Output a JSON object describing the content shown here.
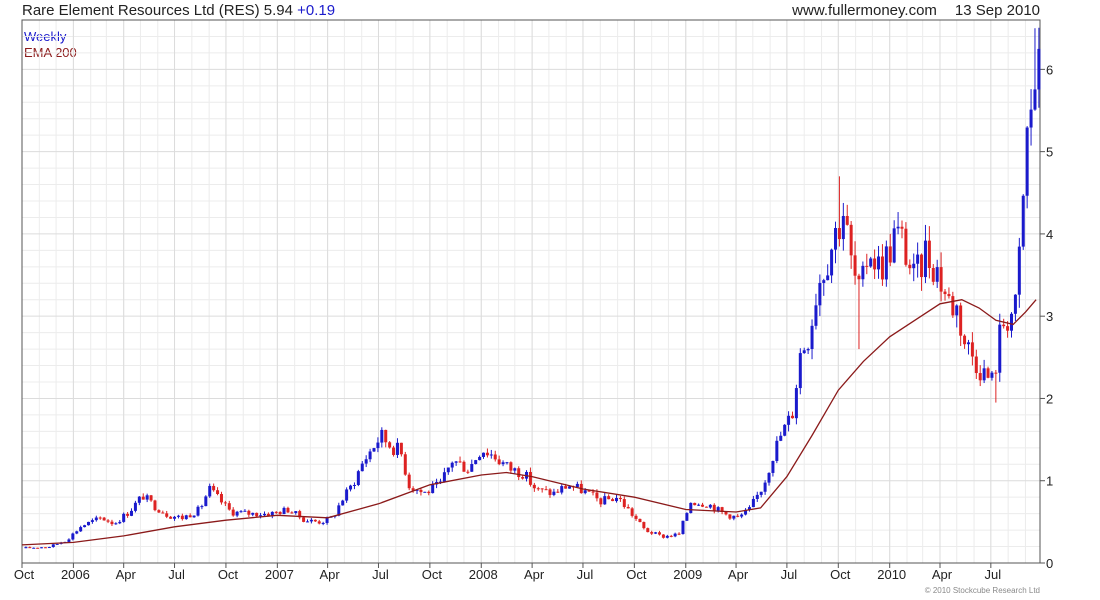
{
  "header": {
    "title": "Rare Element Resources Ltd (RES) 5.94",
    "change": "+0.19",
    "site": "www.fullermoney.com",
    "date": "13 Sep 2010"
  },
  "legend": {
    "weekly": "Weekly",
    "ema": "EMA 200"
  },
  "copyright": "© 2010 Stockcube Research Ltd",
  "colors": {
    "up": "#1a1acc",
    "down": "#dd2222",
    "ema": "#8b1a1a",
    "grid": "#dcdcdc",
    "axis": "#555555"
  },
  "chart_data": {
    "type": "candlestick",
    "frequency": "weekly",
    "ylim": [
      0,
      6.6
    ],
    "yticks": [
      0,
      1,
      2,
      3,
      4,
      5,
      6
    ],
    "xticks": [
      "Oct",
      "2006",
      "Apr",
      "Jul",
      "Oct",
      "2007",
      "Apr",
      "Jul",
      "Oct",
      "2008",
      "Apr",
      "Jul",
      "Oct",
      "2009",
      "Apr",
      "Jul",
      "Oct",
      "2010",
      "Apr",
      "Jul"
    ],
    "xtick_dates": [
      "2005-10-01",
      "2006-01-01",
      "2006-04-01",
      "2006-07-01",
      "2006-10-01",
      "2007-01-01",
      "2007-04-01",
      "2007-07-01",
      "2007-10-01",
      "2008-01-01",
      "2008-04-01",
      "2008-07-01",
      "2008-10-01",
      "2009-01-01",
      "2009-04-01",
      "2009-07-01",
      "2009-10-01",
      "2010-01-01",
      "2010-04-01",
      "2010-07-01"
    ],
    "x_range": [
      "2005-10-01",
      "2010-09-27"
    ],
    "close_path": [
      [
        "2005-10-01",
        0.18
      ],
      [
        "2005-11-20",
        0.2
      ],
      [
        "2005-12-20",
        0.28
      ],
      [
        "2006-01-15",
        0.45
      ],
      [
        "2006-02-20",
        0.55
      ],
      [
        "2006-03-15",
        0.48
      ],
      [
        "2006-04-10",
        0.62
      ],
      [
        "2006-05-05",
        0.82
      ],
      [
        "2006-05-25",
        0.7
      ],
      [
        "2006-06-20",
        0.58
      ],
      [
        "2006-07-15",
        0.55
      ],
      [
        "2006-08-15",
        0.65
      ],
      [
        "2006-09-01",
        0.9
      ],
      [
        "2006-10-10",
        0.62
      ],
      [
        "2006-11-15",
        0.6
      ],
      [
        "2006-12-20",
        0.6
      ],
      [
        "2007-01-20",
        0.65
      ],
      [
        "2007-02-20",
        0.52
      ],
      [
        "2007-03-20",
        0.5
      ],
      [
        "2007-04-10",
        0.55
      ],
      [
        "2007-04-25",
        0.75
      ],
      [
        "2007-05-15",
        0.95
      ],
      [
        "2007-06-05",
        1.25
      ],
      [
        "2007-06-20",
        1.4
      ],
      [
        "2007-07-05",
        1.55
      ],
      [
        "2007-07-20",
        1.45
      ],
      [
        "2007-08-10",
        1.35
      ],
      [
        "2007-08-25",
        0.95
      ],
      [
        "2007-09-20",
        0.85
      ],
      [
        "2007-10-20",
        0.95
      ],
      [
        "2007-11-10",
        1.25
      ],
      [
        "2007-12-10",
        1.15
      ],
      [
        "2008-01-01",
        1.4
      ],
      [
        "2008-01-25",
        1.3
      ],
      [
        "2008-02-20",
        1.15
      ],
      [
        "2008-03-15",
        1.1
      ],
      [
        "2008-04-10",
        0.88
      ],
      [
        "2008-05-10",
        0.85
      ],
      [
        "2008-06-05",
        0.95
      ],
      [
        "2008-07-01",
        0.88
      ],
      [
        "2008-08-01",
        0.75
      ],
      [
        "2008-09-01",
        0.8
      ],
      [
        "2008-09-20",
        0.65
      ],
      [
        "2008-10-20",
        0.4
      ],
      [
        "2008-11-20",
        0.32
      ],
      [
        "2008-12-20",
        0.35
      ],
      [
        "2009-01-10",
        0.75
      ],
      [
        "2009-02-10",
        0.72
      ],
      [
        "2009-03-10",
        0.6
      ],
      [
        "2009-04-05",
        0.55
      ],
      [
        "2009-04-25",
        0.65
      ],
      [
        "2009-05-20",
        0.95
      ],
      [
        "2009-06-05",
        1.3
      ],
      [
        "2009-06-20",
        1.55
      ],
      [
        "2009-07-10",
        1.8
      ],
      [
        "2009-07-25",
        2.55
      ],
      [
        "2009-08-10",
        2.8
      ],
      [
        "2009-08-25",
        3.4
      ],
      [
        "2009-09-10",
        3.7
      ],
      [
        "2009-09-25",
        4.0
      ],
      [
        "2009-10-10",
        4.3
      ],
      [
        "2009-10-25",
        3.6
      ],
      [
        "2009-11-10",
        3.2
      ],
      [
        "2009-11-25",
        3.9
      ],
      [
        "2009-12-10",
        3.6
      ],
      [
        "2009-12-25",
        3.7
      ],
      [
        "2010-01-10",
        4.0
      ],
      [
        "2010-01-25",
        3.9
      ],
      [
        "2010-02-15",
        3.4
      ],
      [
        "2010-03-05",
        3.8
      ],
      [
        "2010-03-25",
        3.6
      ],
      [
        "2010-04-15",
        3.2
      ],
      [
        "2010-05-01",
        3.1
      ],
      [
        "2010-05-15",
        2.7
      ],
      [
        "2010-06-01",
        2.5
      ],
      [
        "2010-06-20",
        2.3
      ],
      [
        "2010-07-05",
        2.2
      ],
      [
        "2010-07-20",
        2.9
      ],
      [
        "2010-08-01",
        3.0
      ],
      [
        "2010-08-15",
        3.1
      ],
      [
        "2010-08-25",
        4.1
      ],
      [
        "2010-09-05",
        5.3
      ],
      [
        "2010-09-20",
        5.94
      ]
    ],
    "ema_200": [
      [
        "2005-10-01",
        0.22
      ],
      [
        "2006-01-01",
        0.25
      ],
      [
        "2006-04-01",
        0.33
      ],
      [
        "2006-07-01",
        0.44
      ],
      [
        "2006-10-01",
        0.52
      ],
      [
        "2007-01-01",
        0.58
      ],
      [
        "2007-04-01",
        0.55
      ],
      [
        "2007-07-01",
        0.72
      ],
      [
        "2007-10-01",
        0.95
      ],
      [
        "2008-01-01",
        1.07
      ],
      [
        "2008-02-15",
        1.1
      ],
      [
        "2008-04-01",
        1.05
      ],
      [
        "2008-07-01",
        0.9
      ],
      [
        "2008-10-01",
        0.8
      ],
      [
        "2009-01-01",
        0.65
      ],
      [
        "2009-04-01",
        0.62
      ],
      [
        "2009-05-15",
        0.67
      ],
      [
        "2009-07-01",
        1.05
      ],
      [
        "2009-08-15",
        1.55
      ],
      [
        "2009-10-01",
        2.1
      ],
      [
        "2009-11-15",
        2.45
      ],
      [
        "2010-01-01",
        2.75
      ],
      [
        "2010-02-15",
        2.95
      ],
      [
        "2010-04-01",
        3.15
      ],
      [
        "2010-05-10",
        3.2
      ],
      [
        "2010-06-10",
        3.1
      ],
      [
        "2010-07-10",
        2.95
      ],
      [
        "2010-08-10",
        2.9
      ],
      [
        "2010-09-01",
        3.05
      ],
      [
        "2010-09-20",
        3.2
      ]
    ],
    "extremes": [
      [
        "2009-10-05",
        "high",
        4.7
      ],
      [
        "2009-11-05",
        "low",
        2.6
      ],
      [
        "2010-07-10",
        "low",
        1.95
      ],
      [
        "2010-09-15",
        "high",
        6.5
      ]
    ]
  }
}
